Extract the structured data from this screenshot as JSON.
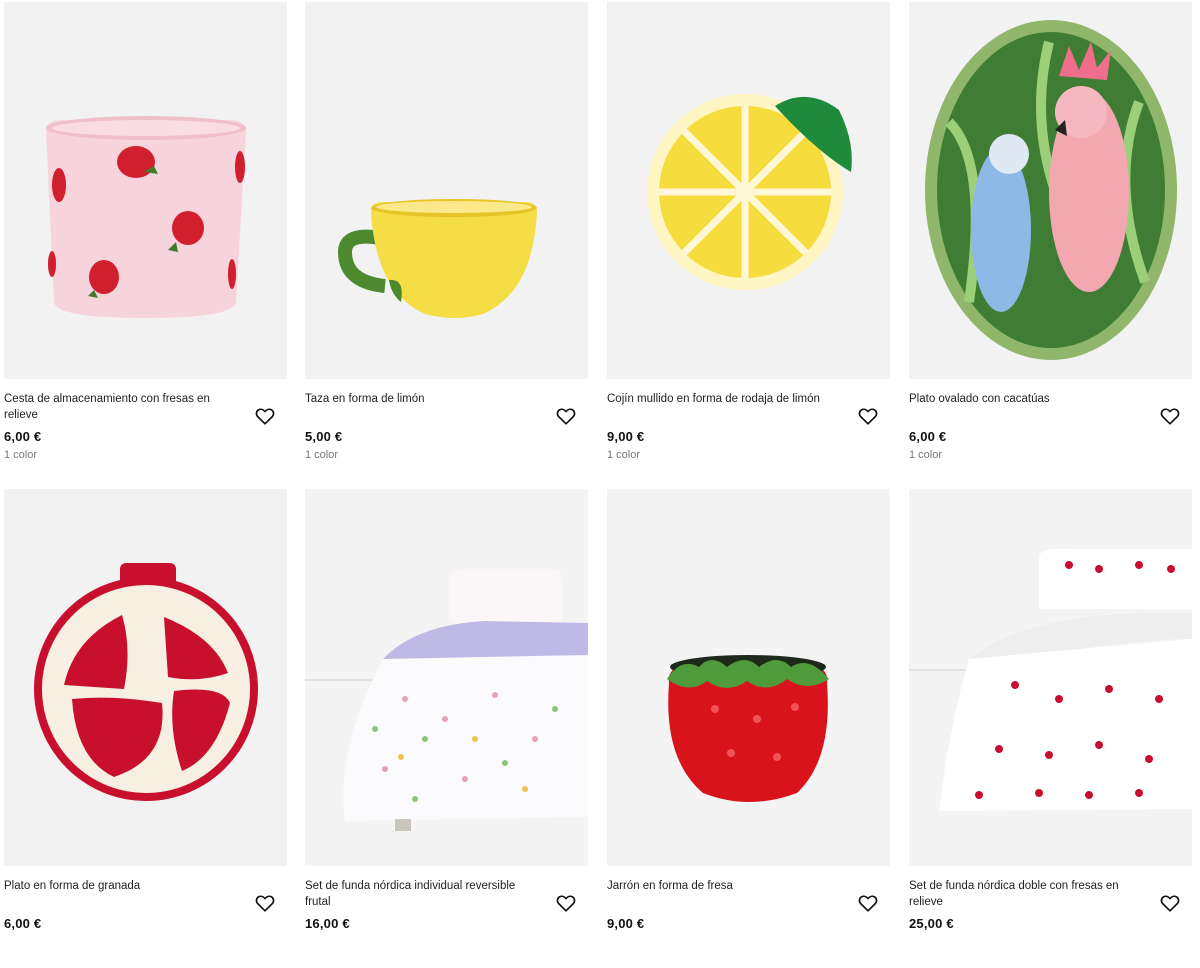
{
  "products": [
    {
      "name": "Cesta de almacenamiento con fresas en relieve",
      "price": "6,00 €",
      "colors": "1 color",
      "image_icon": "strawberry-basket-image"
    },
    {
      "name": "Taza en forma de limón",
      "price": "5,00 €",
      "colors": "1 color",
      "image_icon": "lemon-mug-image"
    },
    {
      "name": "Cojín mullido en forma de rodaja de limón",
      "price": "9,00 €",
      "colors": "1 color",
      "image_icon": "lemon-cushion-image"
    },
    {
      "name": "Plato ovalado con cacatúas",
      "price": "6,00 €",
      "colors": "1 color",
      "image_icon": "cockatoo-plate-image"
    },
    {
      "name": "Plato en forma de granada",
      "price": "6,00 €",
      "colors": "",
      "image_icon": "pomegranate-plate-image"
    },
    {
      "name": "Set de funda nórdica individual reversible frutal",
      "price": "16,00 €",
      "colors": "",
      "image_icon": "fruit-duvet-image"
    },
    {
      "name": "Jarrón en forma de fresa",
      "price": "9,00 €",
      "colors": "",
      "image_icon": "strawberry-vase-image"
    },
    {
      "name": "Set de funda nórdica doble con fresas en relieve",
      "price": "25,00 €",
      "colors": "",
      "image_icon": "strawberry-duvet-image"
    }
  ],
  "favorite_icon": "heart-outline-icon",
  "colors": {
    "image_bg": "#f1f1f1",
    "price": "#111111",
    "muted": "#777777"
  }
}
